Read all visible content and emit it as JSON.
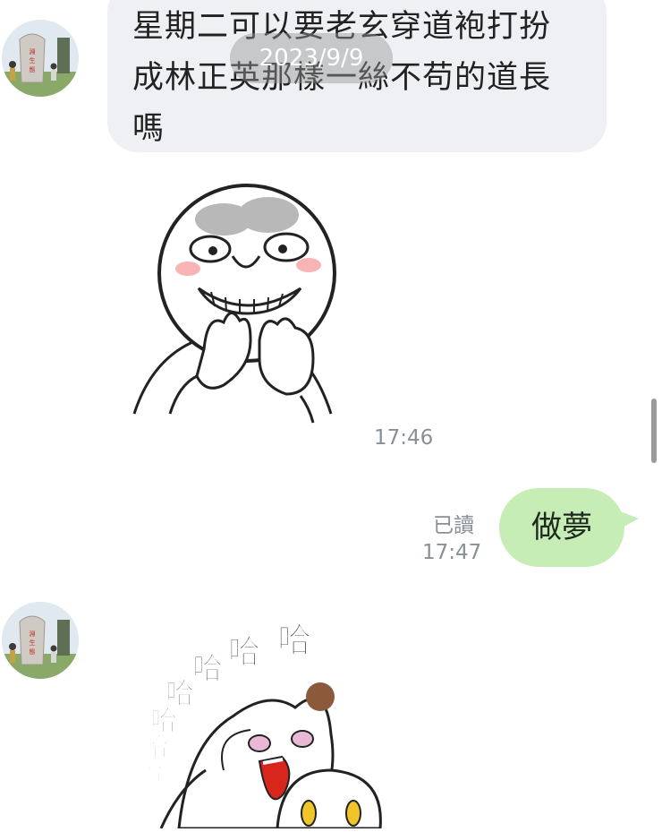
{
  "messages": {
    "incoming_text": "星期二可以要老玄穿道袍打扮成林正英那樣一絲不苟的道長嗎",
    "sticker1_time": "17:46",
    "outgoing_text": "做夢",
    "outgoing_read": "已讀",
    "outgoing_time": "17:47"
  },
  "date_pill": "2023/9/9",
  "avatar_sign_text": "淵生態公園",
  "sticker2_text": [
    "哈",
    "哈",
    "哈",
    "哈",
    "哈",
    "哈",
    "哈",
    "哈",
    "哈"
  ],
  "colors": {
    "incoming_bubble": "#eef0f3",
    "outgoing_bubble": "#c6edb6",
    "time_text": "#8a8f95"
  }
}
